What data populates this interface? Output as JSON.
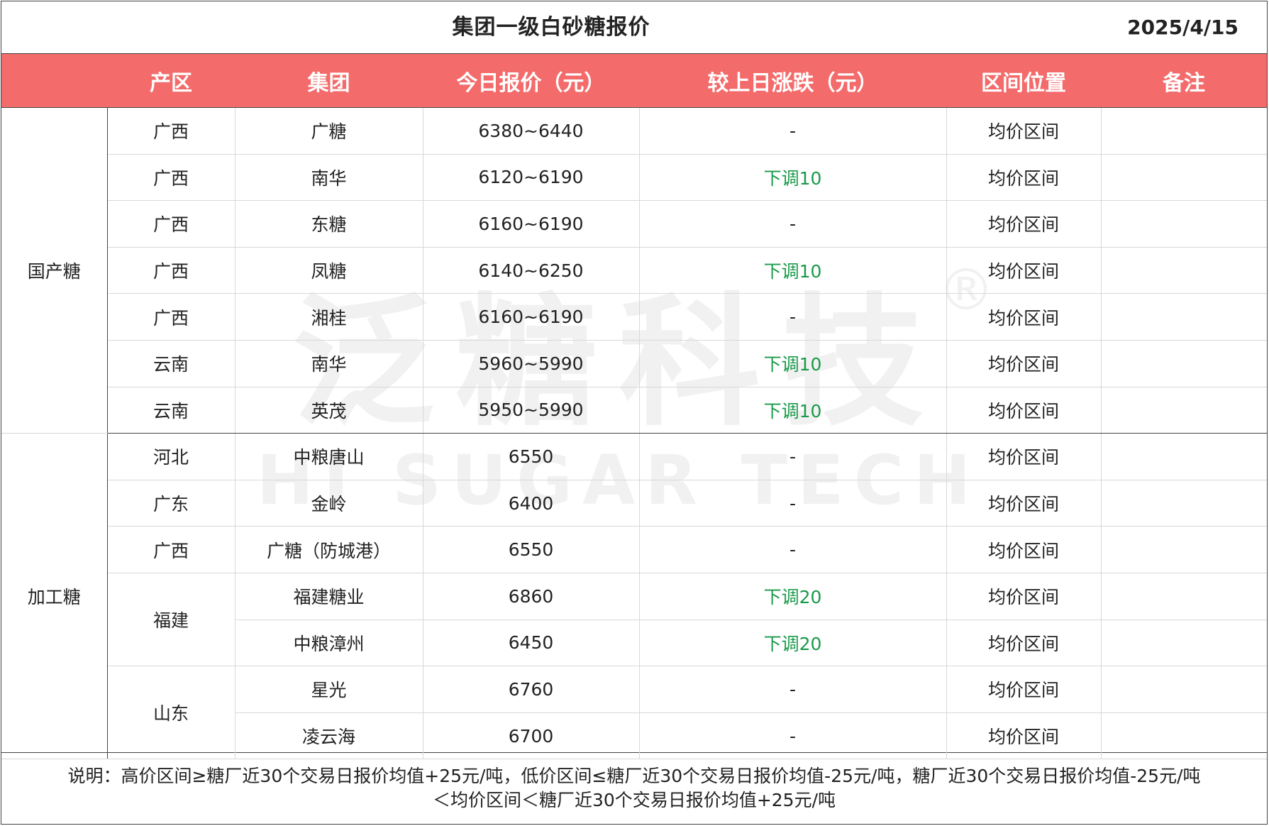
{
  "header": {
    "title": "集团一级白砂糖报价",
    "date": "2025/4/15"
  },
  "columns": [
    "产区",
    "集团",
    "今日报价（元）",
    "较上日涨跌（元）",
    "区间位置",
    "备注"
  ],
  "categories": {
    "domestic": "国产糖",
    "processed": "加工糖"
  },
  "regions": {
    "fujian": "福建",
    "shandong": "山东"
  },
  "rows": [
    {
      "region": "广西",
      "group": "广糖",
      "price": "6380~6440",
      "change": "-",
      "position": "均价区间",
      "remark": ""
    },
    {
      "region": "广西",
      "group": "南华",
      "price": "6120~6190",
      "change": "下调10",
      "position": "均价区间",
      "remark": ""
    },
    {
      "region": "广西",
      "group": "东糖",
      "price": "6160~6190",
      "change": "-",
      "position": "均价区间",
      "remark": ""
    },
    {
      "region": "广西",
      "group": "凤糖",
      "price": "6140~6250",
      "change": "下调10",
      "position": "均价区间",
      "remark": ""
    },
    {
      "region": "广西",
      "group": "湘桂",
      "price": "6160~6190",
      "change": "-",
      "position": "均价区间",
      "remark": ""
    },
    {
      "region": "云南",
      "group": "南华",
      "price": "5960~5990",
      "change": "下调10",
      "position": "均价区间",
      "remark": ""
    },
    {
      "region": "云南",
      "group": "英茂",
      "price": "5950~5990",
      "change": "下调10",
      "position": "均价区间",
      "remark": ""
    },
    {
      "region": "河北",
      "group": "中粮唐山",
      "price": "6550",
      "change": "-",
      "position": "均价区间",
      "remark": ""
    },
    {
      "region": "广东",
      "group": "金岭",
      "price": "6400",
      "change": "-",
      "position": "均价区间",
      "remark": ""
    },
    {
      "region": "广西",
      "group": "广糖（防城港）",
      "price": "6550",
      "change": "-",
      "position": "均价区间",
      "remark": ""
    },
    {
      "region": "福建",
      "group": "福建糖业",
      "price": "6860",
      "change": "下调20",
      "position": "均价区间",
      "remark": ""
    },
    {
      "region": "福建",
      "group": "中粮漳州",
      "price": "6450",
      "change": "下调20",
      "position": "均价区间",
      "remark": ""
    },
    {
      "region": "山东",
      "group": "星光",
      "price": "6760",
      "change": "-",
      "position": "均价区间",
      "remark": ""
    },
    {
      "region": "山东",
      "group": "凌云海",
      "price": "6700",
      "change": "-",
      "position": "均价区间",
      "remark": ""
    }
  ],
  "note": {
    "line1": "说明：高价区间≥糖厂近30个交易日报价均值+25元/吨，低价区间≤糖厂近30个交易日报价均值-25元/吨，糖厂近30个交易日报价均值-25元/吨",
    "line2": "＜均价区间＜糖厂近30个交易日报价均值+25元/吨"
  },
  "watermark": {
    "cn": "泛糖科技",
    "en": "HI SUGAR TECH",
    "reg": "®"
  },
  "colors": {
    "header_bg": "#f36b6b",
    "down": "#1a9a4a"
  }
}
